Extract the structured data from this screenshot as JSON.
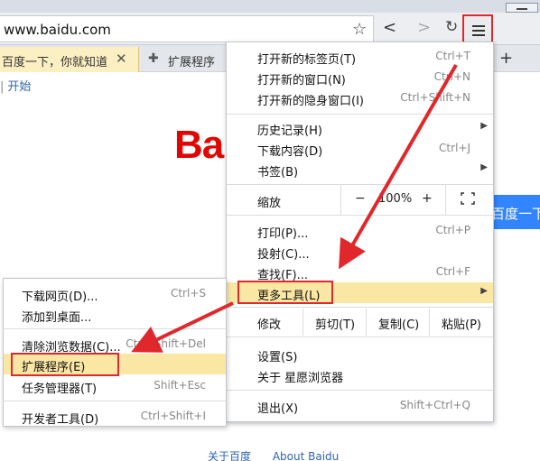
{
  "browser": {
    "url": "www.baidu.com",
    "tabs": [
      {
        "title": "百度一下，你就知道"
      },
      {
        "title": "扩展程序"
      }
    ],
    "bookmark_start": "开始",
    "new_tab_symbol": "+"
  },
  "page": {
    "logo_text": "Bai",
    "search_button": "百度一下",
    "footer_about_cn": "关于百度",
    "footer_about_en": "About Baidu"
  },
  "menu": {
    "new_tab": {
      "label": "打开新的标签页(T)",
      "shortcut": "Ctrl+T"
    },
    "new_window": {
      "label": "打开新的窗口(N)",
      "shortcut": "Ctrl+N"
    },
    "new_incognito": {
      "label": "打开新的隐身窗口(I)",
      "shortcut": "Ctrl+Shift+N"
    },
    "history": {
      "label": "历史记录(H)"
    },
    "downloads": {
      "label": "下载内容(D)",
      "shortcut": "Ctrl+J"
    },
    "bookmarks": {
      "label": "书签(B)"
    },
    "zoom": {
      "label": "缩放",
      "minus": "−",
      "value": "100%",
      "plus": "+"
    },
    "print": {
      "label": "打印(P)...",
      "shortcut": "Ctrl+P"
    },
    "cast": {
      "label": "投射(C)..."
    },
    "find": {
      "label": "查找(F)...",
      "shortcut": "Ctrl+F"
    },
    "more_tools": {
      "label": "更多工具(L)"
    },
    "edit": {
      "label": "修改",
      "cut": "剪切(T)",
      "copy": "复制(C)",
      "paste": "粘贴(P)"
    },
    "settings": {
      "label": "设置(S)"
    },
    "about": {
      "label": "关于 星愿浏览器"
    },
    "exit": {
      "label": "退出(X)",
      "shortcut": "Shift+Ctrl+Q"
    }
  },
  "submenu": {
    "save_page": {
      "label": "下载网页(D)...",
      "shortcut": "Ctrl+S"
    },
    "add_desktop": {
      "label": "添加到桌面..."
    },
    "clear_data": {
      "label": "清除浏览数据(C)...",
      "shortcut": "Ctrl+Shift+Del"
    },
    "extensions": {
      "label": "扩展程序(E)"
    },
    "task_manager": {
      "label": "任务管理器(T)",
      "shortcut": "Shift+Esc"
    },
    "dev_tools": {
      "label": "开发者工具(D)",
      "shortcut": "Ctrl+Shift+I"
    }
  },
  "colors": {
    "highlight": "#fbe7a4",
    "annotation_red": "#e0282c",
    "baidu_red": "#e10601",
    "baidu_blue": "#3385ff"
  }
}
